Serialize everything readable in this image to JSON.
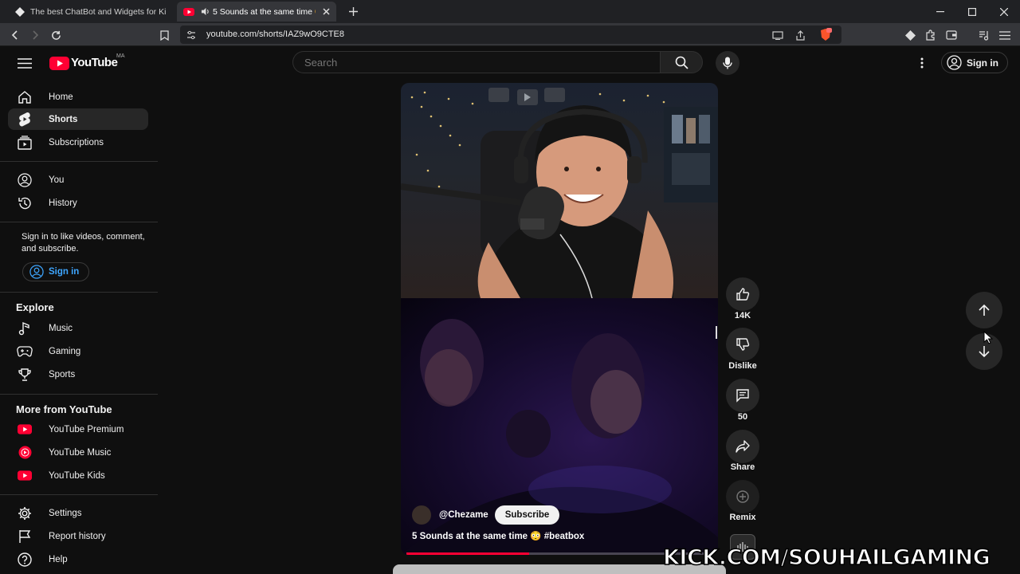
{
  "browser": {
    "tabs": [
      {
        "title": "The best ChatBot and Widgets for Ki",
        "icon": "site-icon"
      },
      {
        "title": "5 Sounds at the same time 😳",
        "icon": "youtube-icon",
        "audio": true
      }
    ],
    "url": "youtube.com/shorts/IAZ9wO9CTE8"
  },
  "masthead": {
    "logo": "YouTube",
    "country_code": "MA",
    "search_placeholder": "Search",
    "sign_in": "Sign in"
  },
  "sidebar": {
    "primary": [
      {
        "label": "Home",
        "icon": "home-icon"
      },
      {
        "label": "Shorts",
        "icon": "shorts-icon",
        "selected": true
      },
      {
        "label": "Subscriptions",
        "icon": "subscriptions-icon"
      }
    ],
    "you": [
      {
        "label": "You",
        "icon": "you-icon"
      },
      {
        "label": "History",
        "icon": "history-icon"
      }
    ],
    "signin_prompt": "Sign in to like videos, comment, and subscribe.",
    "signin_button": "Sign in",
    "explore_title": "Explore",
    "explore": [
      {
        "label": "Music",
        "icon": "music-icon"
      },
      {
        "label": "Gaming",
        "icon": "gaming-icon"
      },
      {
        "label": "Sports",
        "icon": "sports-icon"
      }
    ],
    "more_title": "More from YouTube",
    "more": [
      {
        "label": "YouTube Premium",
        "icon": "youtube-premium-icon"
      },
      {
        "label": "YouTube Music",
        "icon": "youtube-music-icon"
      },
      {
        "label": "YouTube Kids",
        "icon": "youtube-kids-icon"
      }
    ],
    "footer": [
      {
        "label": "Settings",
        "icon": "settings-icon"
      },
      {
        "label": "Report history",
        "icon": "flag-icon"
      },
      {
        "label": "Help",
        "icon": "help-icon"
      }
    ]
  },
  "short": {
    "channel": "@Chezame",
    "subscribe": "Subscribe",
    "title": "5 Sounds at the same time 😳 #beatbox",
    "progress_fraction": 0.4
  },
  "actions": {
    "likes": "14K",
    "dislike": "Dislike",
    "comments": "50",
    "share": "Share",
    "remix": "Remix"
  },
  "watermark": "KICK.COM/SOUHAILGAMING",
  "colors": {
    "accent": "#ff0033",
    "link": "#3ea6ff",
    "background": "#0f0f0f"
  }
}
